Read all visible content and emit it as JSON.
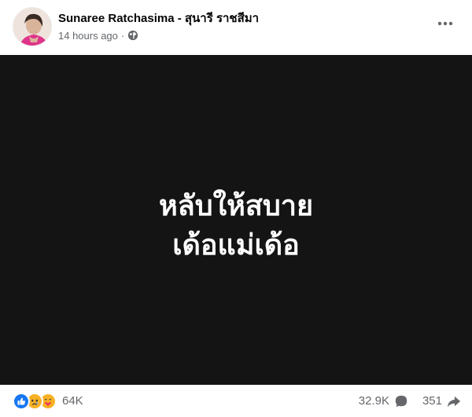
{
  "post": {
    "author_name": "Sunaree Ratchasima - สุนารี ราชสีมา",
    "timestamp": "14 hours ago",
    "separator": "·",
    "privacy_icon": "globe-icon",
    "more_icon": "more-options-icon",
    "media_text_lines": [
      "หลับให้สบาย",
      "เด้อแม่เด้อ"
    ],
    "media_bg_color": "#141414",
    "reactions": {
      "icons": [
        "like-icon",
        "sad-icon",
        "care-icon"
      ],
      "count": "64K"
    },
    "comments_count": "32.9K",
    "shares_count": "351",
    "accent_color": "#1877f2"
  }
}
